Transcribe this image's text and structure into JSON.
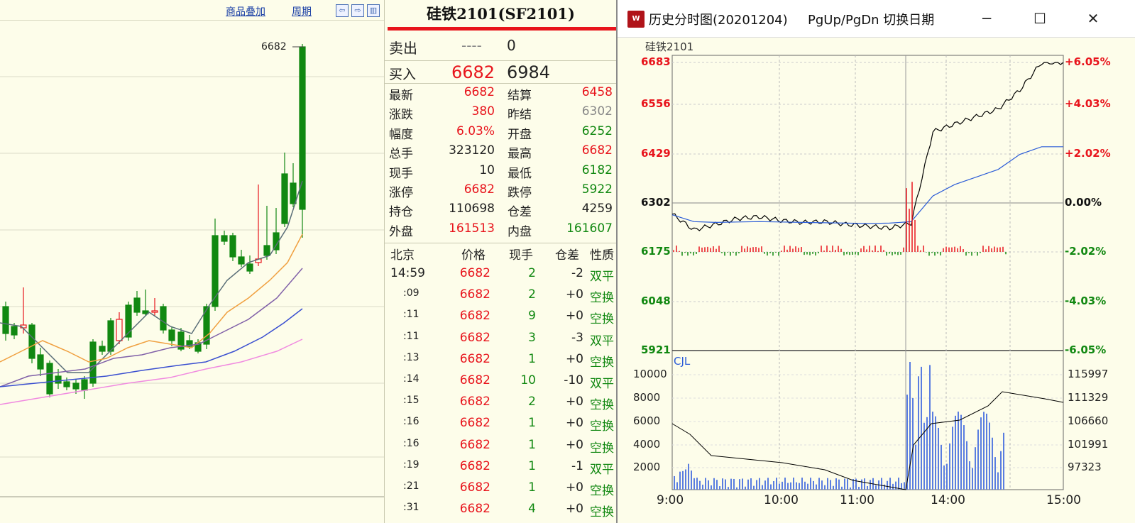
{
  "kline": {
    "links": [
      "商品叠加",
      "周期"
    ],
    "nav_buttons": [
      "⇦",
      "⇨",
      "▥"
    ],
    "peak_label": "6682"
  },
  "quote": {
    "title": "硅铁2101(SF2101)",
    "sell": {
      "label": "卖出",
      "price": "----",
      "vol": "0"
    },
    "buy": {
      "label": "买入",
      "price": "6682",
      "vol": "6984"
    },
    "fields": [
      {
        "l1": "最新",
        "v1": "6682",
        "c1": "red",
        "l2": "结算",
        "v2": "6458",
        "c2": "red"
      },
      {
        "l1": "涨跌",
        "v1": "380",
        "c1": "red",
        "l2": "昨结",
        "v2": "6302",
        "c2": "gry"
      },
      {
        "l1": "幅度",
        "v1": "6.03%",
        "c1": "red",
        "l2": "开盘",
        "v2": "6252",
        "c2": "grn"
      },
      {
        "l1": "总手",
        "v1": "323120",
        "c1": "blk",
        "l2": "最高",
        "v2": "6682",
        "c2": "red"
      },
      {
        "l1": "现手",
        "v1": "10",
        "c1": "blk",
        "l2": "最低",
        "v2": "6182",
        "c2": "grn"
      },
      {
        "l1": "涨停",
        "v1": "6682",
        "c1": "red",
        "l2": "跌停",
        "v2": "5922",
        "c2": "grn"
      },
      {
        "l1": "持仓",
        "v1": "110698",
        "c1": "blk",
        "l2": "仓差",
        "v2": "4259",
        "c2": "blk"
      },
      {
        "l1": "外盘",
        "v1": "161513",
        "c1": "red",
        "l2": "内盘",
        "v2": "161607",
        "c2": "grn"
      }
    ],
    "tick_header": [
      "北京",
      "价格",
      "现手",
      "仓差",
      "性质"
    ],
    "ticks": [
      {
        "time": "14:59",
        "price": "6682",
        "qty": "2",
        "oi": "-2",
        "nature": "双平",
        "nc": "grn"
      },
      {
        "time": ":09",
        "price": "6682",
        "qty": "2",
        "oi": "+0",
        "nature": "空换",
        "nc": "grn"
      },
      {
        "time": ":11",
        "price": "6682",
        "qty": "9",
        "oi": "+0",
        "nature": "空换",
        "nc": "grn"
      },
      {
        "time": ":11",
        "price": "6682",
        "qty": "3",
        "oi": "-3",
        "nature": "双平",
        "nc": "grn"
      },
      {
        "time": ":13",
        "price": "6682",
        "qty": "1",
        "oi": "+0",
        "nature": "空换",
        "nc": "grn"
      },
      {
        "time": ":14",
        "price": "6682",
        "qty": "10",
        "oi": "-10",
        "nature": "双平",
        "nc": "grn"
      },
      {
        "time": ":15",
        "price": "6682",
        "qty": "2",
        "oi": "+0",
        "nature": "空换",
        "nc": "grn"
      },
      {
        "time": ":16",
        "price": "6682",
        "qty": "1",
        "oi": "+0",
        "nature": "空换",
        "nc": "grn"
      },
      {
        "time": ":16",
        "price": "6682",
        "qty": "1",
        "oi": "+0",
        "nature": "空换",
        "nc": "grn"
      },
      {
        "time": ":19",
        "price": "6682",
        "qty": "1",
        "oi": "-1",
        "nature": "双平",
        "nc": "grn"
      },
      {
        "time": ":21",
        "price": "6682",
        "qty": "1",
        "oi": "+0",
        "nature": "空换",
        "nc": "grn"
      },
      {
        "time": ":31",
        "price": "6682",
        "qty": "4",
        "oi": "+0",
        "nature": "空换",
        "nc": "grn"
      }
    ]
  },
  "popup": {
    "title": "历史分时图(20201204)",
    "hint": "PgUp/PgDn 切换日期",
    "buttons": [
      "─",
      "☐",
      "✕"
    ],
    "symbol": "硅铁2101",
    "volume_label": "CJL"
  },
  "chart_data": [
    {
      "type": "line",
      "title": "硅铁2101",
      "x": [
        "9:00",
        "10:00",
        "11:00",
        "14:00",
        "15:00"
      ],
      "y_ticks_left": [
        6683,
        6556,
        6429,
        6302,
        6175,
        6048,
        5921
      ],
      "y_ticks_right": [
        "+6.05%",
        "+4.03%",
        "+2.02%",
        "0.00%",
        "-2.02%",
        "-4.03%",
        "-6.05%"
      ],
      "ylim": [
        5921,
        6683
      ],
      "reference": 6302,
      "series": [
        {
          "values": [
            6282,
            6240,
            6255,
            6270,
            6275,
            6265,
            6260,
            6262,
            6255,
            6250,
            6245,
            6258,
            6500,
            6520,
            6540,
            6560,
            6610,
            6683,
            6683
          ]
        },
        {
          "values": [
            6280,
            6262,
            6260,
            6261,
            6262,
            6261,
            6260,
            6259,
            6258,
            6257,
            6258,
            6262,
            6330,
            6360,
            6380,
            6400,
            6440,
            6460,
            6460
          ]
        }
      ]
    },
    {
      "type": "bar",
      "title": "CJL",
      "x": [
        "9:00",
        "10:00",
        "11:00",
        "14:00",
        "15:00"
      ],
      "y_ticks_left": [
        10000,
        8000,
        6000,
        4000,
        2000
      ],
      "y_ticks_right": [
        115997,
        111329,
        106660,
        101991,
        97323
      ]
    }
  ],
  "colors": {
    "up": "#e8141c",
    "down": "#118811",
    "price_line": "#000000",
    "avg_line": "#2a5bd7",
    "volume": "#5a7de0"
  }
}
